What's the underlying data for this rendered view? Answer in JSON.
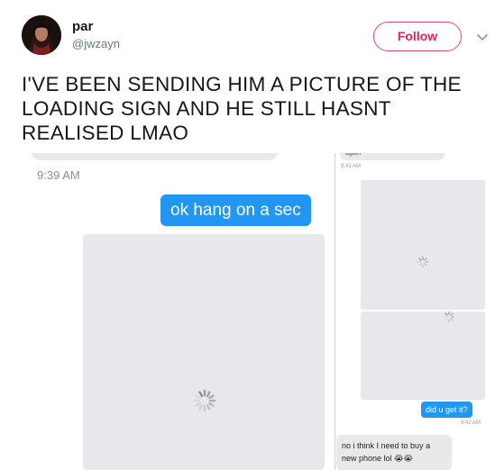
{
  "tweet": {
    "display_name": "par",
    "handle": "@jwzayn",
    "follow_label": "Follow",
    "text": "I'VE BEEN SENDING HIM A PICTURE OF THE LOADING SIGN AND HE STILL HASNT REALISED LMAO",
    "icons": {
      "avatar": "profile-photo",
      "more": "chevron-down-icon"
    },
    "colors": {
      "follow": "#e0245e",
      "text": "#14171a",
      "handle": "#657786"
    }
  },
  "media": {
    "left": {
      "time": "9:39 AM",
      "sent_message": "ok hang on a sec",
      "image": "loading-spinner-icon"
    },
    "right": {
      "prev_message": "again",
      "time_top": "9:41 AM",
      "sent_message": "did u get it?",
      "time_mid": "9:42 AM",
      "received_message": "no i think I need to buy a new phone lol 😭😭",
      "image": "loading-spinner-icon"
    },
    "colors": {
      "bubble_sent": "#2196f3",
      "bubble_received": "#e9e9eb",
      "image_placeholder": "#e7e8ec"
    }
  }
}
